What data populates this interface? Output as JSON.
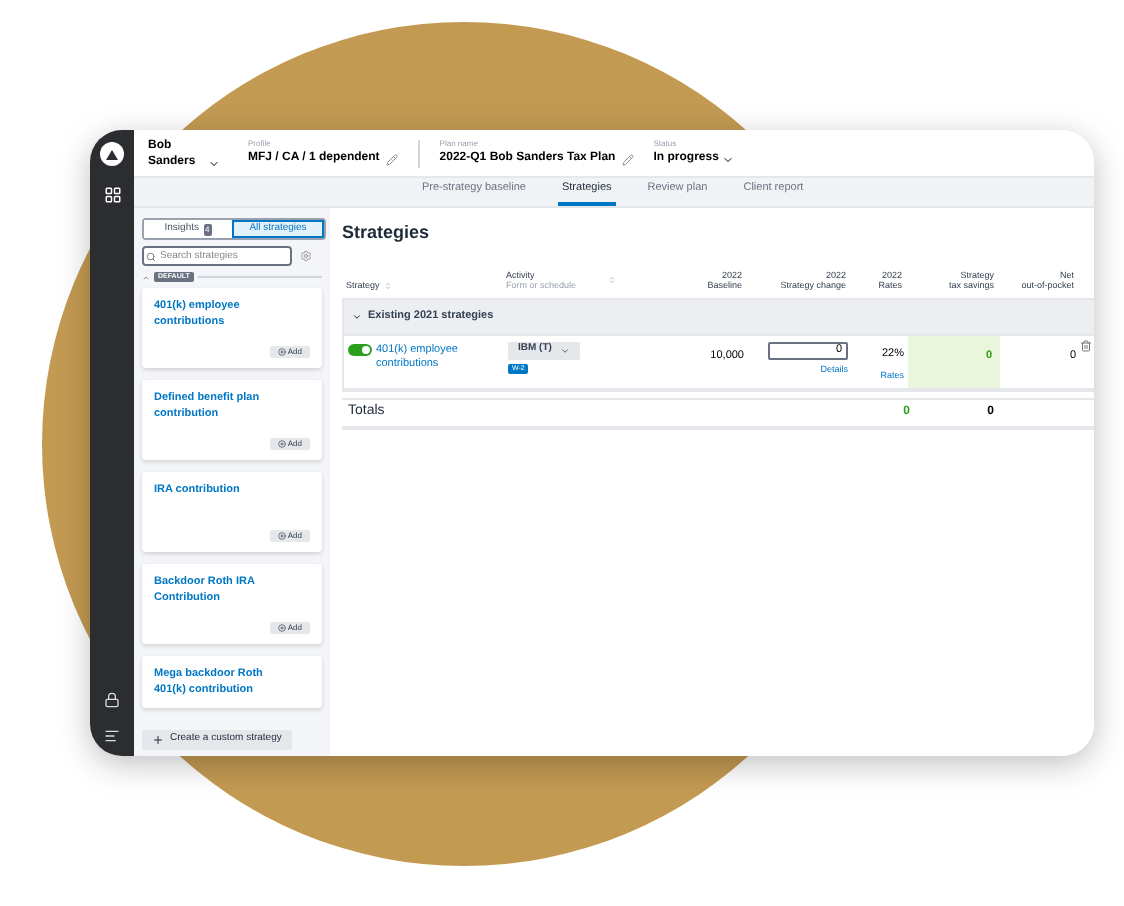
{
  "header": {
    "client_name": "Bob Sanders",
    "profile_label": "Profile",
    "profile": "MFJ / CA / 1 dependent",
    "plan_label": "Plan name",
    "plan": "2022-Q1 Bob Sanders Tax Plan",
    "status_label": "Status",
    "status": "In progress"
  },
  "tabs": [
    {
      "label": "Pre-strategy baseline",
      "selected": false
    },
    {
      "label": "Strategies",
      "selected": true
    },
    {
      "label": "Review plan",
      "selected": false
    },
    {
      "label": "Client report",
      "selected": false
    }
  ],
  "sidebar": {
    "toggle": [
      {
        "label": "Insights",
        "badge": "4",
        "selected": false
      },
      {
        "label": "All strategies",
        "selected": true
      }
    ],
    "search_placeholder": "Search strategies",
    "section_tag": "DEFAULT",
    "cards": [
      {
        "title": "401(k) employee contributions",
        "button": "Add"
      },
      {
        "title": "Defined benefit plan contribution",
        "button": "Add"
      },
      {
        "title": "IRA contribution",
        "button": "Add"
      },
      {
        "title": "Backdoor Roth IRA Contribution",
        "button": "Add"
      },
      {
        "title": "Mega backdoor Roth 401(k) contribution"
      }
    ],
    "create_button": "Create a custom strategy"
  },
  "main": {
    "title": "Strategies",
    "columns": [
      {
        "lines": [
          "Strategy"
        ],
        "sortable": true
      },
      {
        "lines": [
          "Activity"
        ],
        "sublabel": "Form or schedule",
        "sortable": true
      },
      {
        "lines": [
          "2022",
          "Baseline"
        ],
        "sortable": false
      },
      {
        "lines": [
          "2022",
          "Strategy change"
        ],
        "sortable": false
      },
      {
        "lines": [
          "2022",
          "Rates"
        ],
        "sortable": false
      },
      {
        "lines": [
          "Strategy",
          "tax savings"
        ],
        "sortable": false
      },
      {
        "lines": [
          "Net",
          "out-of-pocket"
        ],
        "sortable": false
      }
    ],
    "group": {
      "label": "Existing 2021 strategies",
      "expanded": true
    },
    "rows": [
      {
        "on": true,
        "name": "401(k) employee contributions",
        "activity": "IBM (T)",
        "activity_tag": "W-2",
        "baseline": "10,000",
        "change": "0",
        "change_link": "Details",
        "rate": "22%",
        "rate_link": "Rates",
        "savings": "0",
        "net": "0"
      }
    ],
    "totals": {
      "label": "Totals",
      "savings": "0",
      "net": "0"
    }
  }
}
